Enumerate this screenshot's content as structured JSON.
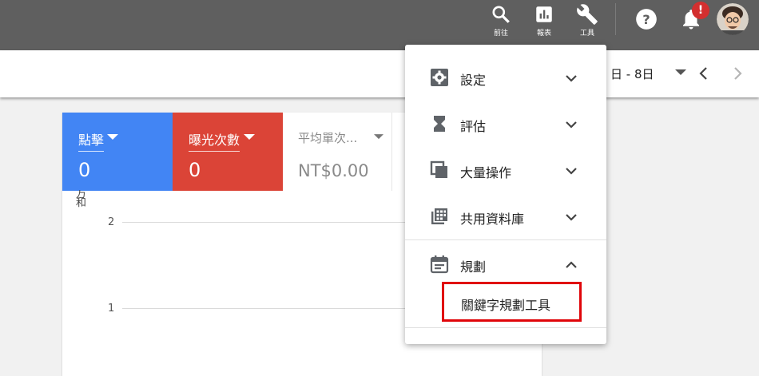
{
  "topbar": {
    "goto_label": "前往",
    "reports_label": "報表",
    "tools_label": "工具",
    "notification_count": "!",
    "icons": [
      "search-icon",
      "reports-icon",
      "wrench-icon",
      "help-icon",
      "bell-icon",
      "avatar"
    ]
  },
  "date": {
    "range_text": "日 - 8日"
  },
  "metrics": {
    "clicks": {
      "label": "點擊",
      "value": "0",
      "color": "#4285f4"
    },
    "impressions": {
      "label": "曝光次數",
      "value": "0",
      "color": "#db4437"
    },
    "avg_cpc": {
      "label": "平均單次...",
      "value": "NT$0.00"
    }
  },
  "chart": {
    "cut_label": "万\n和",
    "y_ticks": [
      "2",
      "1"
    ]
  },
  "tools_menu": {
    "items": [
      {
        "label": "設定",
        "icon": "gear-icon",
        "expanded": false
      },
      {
        "label": "評估",
        "icon": "hourglass-icon",
        "expanded": false
      },
      {
        "label": "大量操作",
        "icon": "copy-icon",
        "expanded": false
      },
      {
        "label": "共用資料庫",
        "icon": "grid-library-icon",
        "expanded": false
      },
      {
        "label": "規劃",
        "icon": "calendar-icon",
        "expanded": true
      }
    ],
    "sub_item": "關鍵字規劃工具"
  }
}
